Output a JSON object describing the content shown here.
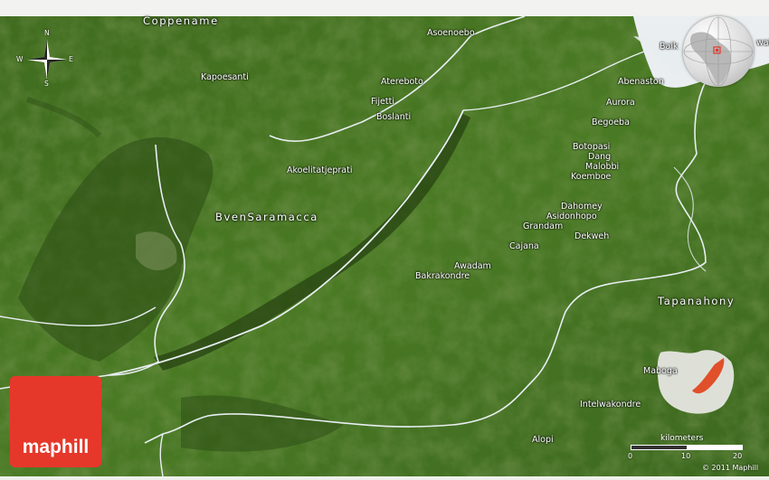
{
  "map": {
    "region_labels": [
      "Coppename",
      "BvenSaramacca",
      "Tapanahony"
    ],
    "place_labels": [
      "Asoenoebo",
      "Kapoesanti",
      "Atereboto",
      "Fijetti",
      "Boslanti",
      "Akoelitatjeprati",
      "Abenaston",
      "Aurora",
      "Begoeba",
      "Botopasi",
      "Dang",
      "Malobbi",
      "Koemboe",
      "Dahomey",
      "Asidonhopo",
      "Grandam",
      "Dekweh",
      "Cajana",
      "Awadam",
      "Bakrakondre",
      "Maboga",
      "Intelwakondre",
      "Alopi"
    ],
    "partial_labels": [
      "Baik",
      "wai"
    ],
    "compass": {
      "north": "N",
      "south": "S",
      "east": "E",
      "west": "W"
    },
    "scale": {
      "unit": "kilometers",
      "ticks": [
        "0",
        "10",
        "20"
      ]
    },
    "brand": "maphill",
    "copyright": "© 2011 Maphill"
  }
}
